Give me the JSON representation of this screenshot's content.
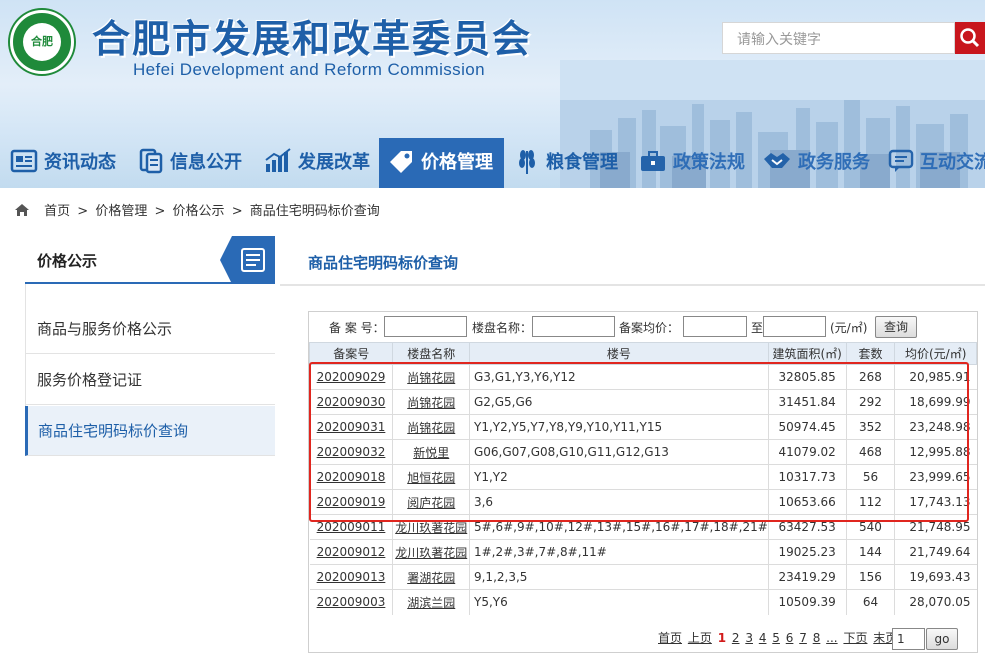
{
  "header": {
    "title": "合肥市发展和改革委员会",
    "subtitle": "Hefei Development and Reform Commission",
    "logo_text": "合肥",
    "search_placeholder": "请输入关键字",
    "accent": "#2a6ab6",
    "search_button_color": "#c8161d"
  },
  "nav": {
    "items": [
      {
        "label": "资讯动态",
        "icon": "news-icon"
      },
      {
        "label": "信息公开",
        "icon": "document-icon"
      },
      {
        "label": "发展改革",
        "icon": "bar-chart-icon"
      },
      {
        "label": "价格管理",
        "icon": "price-tag-icon",
        "active": true
      },
      {
        "label": "粮食管理",
        "icon": "wheat-icon"
      },
      {
        "label": "政策法规",
        "icon": "briefcase-icon"
      },
      {
        "label": "政务服务",
        "icon": "handshake-icon"
      },
      {
        "label": "互动交流",
        "icon": "chat-icon"
      }
    ]
  },
  "breadcrumb": {
    "items": [
      "首页",
      "价格管理",
      "价格公示",
      "商品住宅明码标价查询"
    ],
    "separator": ">"
  },
  "sidebar": {
    "title": "价格公示",
    "items": [
      {
        "label": "商品与服务价格公示"
      },
      {
        "label": "服务价格登记证"
      },
      {
        "label": "商品住宅明码标价查询",
        "active": true
      }
    ]
  },
  "main": {
    "title": "商品住宅明码标价查询",
    "filter": {
      "record_no_label": "备 案 号：",
      "project_label": "楼盘名称：",
      "avg_price_label": "备案均价：",
      "to_label": "至",
      "unit_label": "(元/㎡)",
      "query_button": "查询"
    },
    "table": {
      "headers": [
        "备案号",
        "楼盘名称",
        "楼号",
        "建筑面积(㎡)",
        "套数",
        "均价(元/㎡)"
      ],
      "rows": [
        [
          "202009029",
          "尚锦花园",
          "G3,G1,Y3,Y6,Y12",
          "32805.85",
          "268",
          "20,985.91"
        ],
        [
          "202009030",
          "尚锦花园",
          "G2,G5,G6",
          "31451.84",
          "292",
          "18,699.99"
        ],
        [
          "202009031",
          "尚锦花园",
          "Y1,Y2,Y5,Y7,Y8,Y9,Y10,Y11,Y15",
          "50974.45",
          "352",
          "23,248.98"
        ],
        [
          "202009032",
          "新悦里",
          "G06,G07,G08,G10,G11,G12,G13",
          "41079.02",
          "468",
          "12,995.88"
        ],
        [
          "202009018",
          "旭恒花园",
          "Y1,Y2",
          "10317.73",
          "56",
          "23,999.65"
        ],
        [
          "202009019",
          "阅庐花园",
          "3,6",
          "10653.66",
          "112",
          "17,743.13"
        ],
        [
          "202009011",
          "龙川玖著花园",
          "5#,6#,9#,10#,12#,13#,15#,16#,17#,18#,21#",
          "63427.53",
          "540",
          "21,748.95"
        ],
        [
          "202009012",
          "龙川玖著花园",
          "1#,2#,3#,7#,8#,11#",
          "19025.23",
          "144",
          "21,749.64"
        ],
        [
          "202009013",
          "署湖花园",
          "9,1,2,3,5",
          "23419.29",
          "156",
          "19,693.43"
        ],
        [
          "202009003",
          "湖滨兰园",
          "Y5,Y6",
          "10509.39",
          "64",
          "28,070.05"
        ]
      ]
    },
    "pager": {
      "first": "首页",
      "prev": "上页",
      "pages": [
        "1",
        "2",
        "3",
        "4",
        "5",
        "6",
        "7",
        "8"
      ],
      "current": "1",
      "ellipsis": "...",
      "next": "下页",
      "last": "末页",
      "goto_value": "1",
      "go_button": "go"
    }
  }
}
